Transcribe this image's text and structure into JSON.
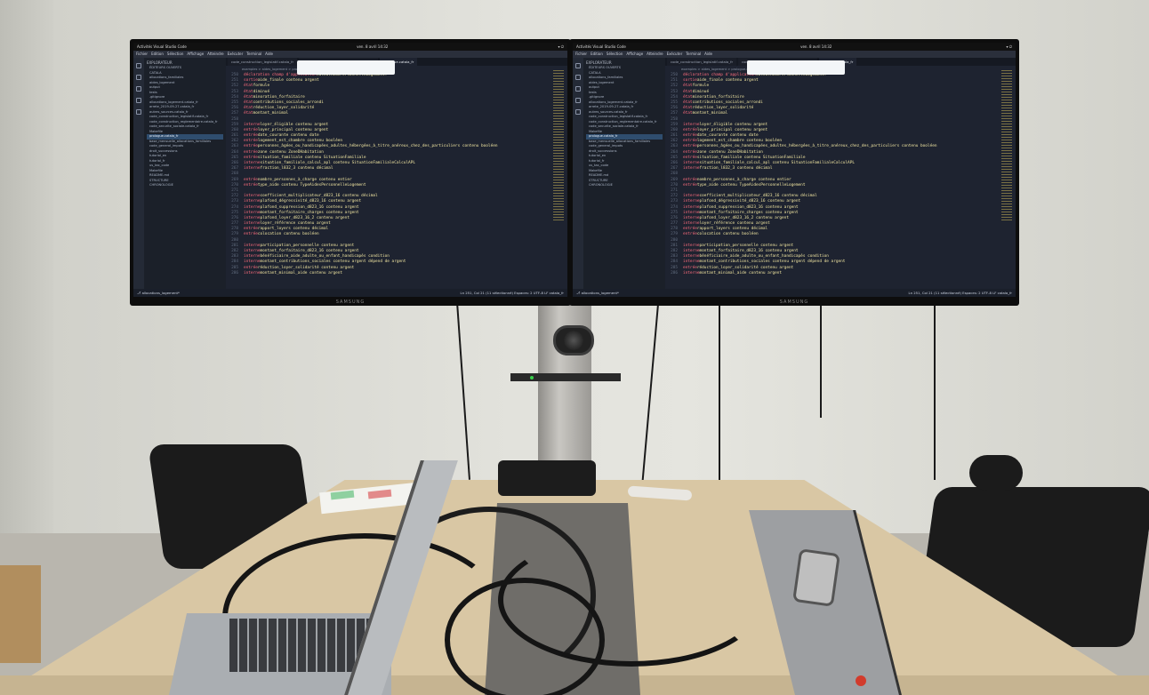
{
  "scene": "Meeting room with two Samsung monitors showing Visual Studio Code",
  "monitors": {
    "brand": "SAMSUNG",
    "left": {
      "topbar_left": "Activités   Visual Studio Code",
      "topbar_center": "ven. 8 avril 14:32",
      "menu": [
        "Fichier",
        "Edition",
        "Sélection",
        "Affichage",
        "Atteindre",
        "Exécuter",
        "Terminal",
        "Aide"
      ],
      "explorer_title": "EXPLORATEUR",
      "explorer_items": [
        "ÉDITEURS OUVERTS",
        "CATALA",
        "allocations_familiales",
        "aides_logement",
        "output",
        "tests",
        ".gitignore",
        "allocations_logement.catala_fr",
        "arrete_2019-09-27.catala_fr",
        "autres_sources.catala_fr",
        "code_construction_legislatif.catala_fr",
        "code_construction_reglementaire.catala_fr",
        "code_securite_sociale.catala_fr",
        "Makefile",
        "prologue.catala_fr",
        "base_mensuelle_allocations_familiales",
        "code_general_impots",
        "droit_successions",
        "tutorial_en",
        "tutorial_fr",
        "us_tax_code",
        "Makefile",
        "README.md",
        "STRUCTURE",
        "CHRONOLOGIE"
      ],
      "tabs": [
        "code_construction_legislatif.catala_fr",
        "code_construction_reglementaire.catala_fr",
        "prologue.catala_fr"
      ],
      "breadcrumb": "examples > aides_logement > prologue.catala_fr",
      "status": "Ln 251, Col 21 (11 sélectionné)   Espaces: 2   UTF-8   LF   catala_fr"
    },
    "right": {
      "topbar_left": "Activités   Visual Studio Code",
      "topbar_center": "ven. 8 avril 14:32",
      "menu": [
        "Fichier",
        "Edition",
        "Sélection",
        "Affichage",
        "Atteindre",
        "Exécuter",
        "Terminal",
        "Aide"
      ],
      "explorer_title": "EXPLORATEUR",
      "explorer_items": [
        "ÉDITEURS OUVERTS",
        "CATALA",
        "allocations_familiales",
        "aides_logement",
        "output",
        "tests",
        ".gitignore",
        "allocations_logement.catala_fr",
        "arrete_2019-09-27.catala_fr",
        "autres_sources.catala_fr",
        "code_construction_legislatif.catala_fr",
        "code_construction_reglementaire.catala_fr",
        "code_securite_sociale.catala_fr",
        "Makefile",
        "prologue.catala_fr",
        "base_mensuelle_allocations_familiales",
        "code_general_impots",
        "droit_successions",
        "tutorial_en",
        "tutorial_fr",
        "us_tax_code",
        "Makefile",
        "README.md",
        "STRUCTURE",
        "CHRONOLOGIE"
      ],
      "tabs": [
        "code_construction_legislatif.catala_fr",
        "code_construction_reglementaire.catala_fr",
        "prologue.catala_fr"
      ],
      "breadcrumb": "examples > aides_logement > prologue.catala_fr",
      "status": "Ln 251, Col 21 (11 sélectionné)   Espaces: 2   UTF-8   LF   catala_fr"
    }
  },
  "code_lines": [
    {
      "n": "250",
      "kw": "déclaration champ d'application",
      "tx": " CalculAidePersonnelleLogement:"
    },
    {
      "n": "251",
      "kw": "  sortie",
      "tx": " aide_finale contenu argent"
    },
    {
      "n": "252",
      "kw": "  état",
      "tx": " formule"
    },
    {
      "n": "253",
      "kw": "  état",
      "tx": " diminué"
    },
    {
      "n": "254",
      "kw": "  état",
      "tx": " minoration_forfaitaire"
    },
    {
      "n": "255",
      "kw": "  état",
      "tx": " contributions_sociales_arrondi"
    },
    {
      "n": "256",
      "kw": "  état",
      "tx": " réduction_loyer_solidarité"
    },
    {
      "n": "257",
      "kw": "  état",
      "tx": " montant_minimal"
    },
    {
      "n": "258",
      "kw": "",
      "tx": ""
    },
    {
      "n": "259",
      "kw": "  interne",
      "tx": " loyer_éligible contenu argent"
    },
    {
      "n": "260",
      "kw": "  entrée",
      "tx": " loyer_principal contenu argent"
    },
    {
      "n": "261",
      "kw": "  entrée",
      "tx": " date_courante contenu date"
    },
    {
      "n": "262",
      "kw": "  entrée",
      "tx": " logement_est_chambre contenu booléen"
    },
    {
      "n": "263",
      "kw": "  entrée",
      "tx": " personnes_âgées_ou_handicapées_adultes_hébergées_à_titre_onéreux_chez_des_particuliers contenu booléen"
    },
    {
      "n": "264",
      "kw": "  entrée",
      "tx": " zone contenu ZoneDHabitation"
    },
    {
      "n": "265",
      "kw": "  entrée",
      "tx": " situation_familiale contenu SituationFamiliale"
    },
    {
      "n": "266",
      "kw": "  interne",
      "tx": " situation_familiale_calcul_apl contenu SituationFamilialeCalculAPL"
    },
    {
      "n": "267",
      "kw": "  interne",
      "tx": " fraction_l832_3 contenu décimal"
    },
    {
      "n": "268",
      "kw": "",
      "tx": ""
    },
    {
      "n": "269",
      "kw": "  entrée",
      "tx": " nombre_personnes_à_charge contenu entier"
    },
    {
      "n": "270",
      "kw": "  entrée",
      "tx": " type_aide contenu TypeAidesPersonnelleLogement"
    },
    {
      "n": "271",
      "kw": "",
      "tx": ""
    },
    {
      "n": "272",
      "kw": "  interne",
      "tx": " coefficient_multiplicateur_d823_16 contenu décimal"
    },
    {
      "n": "273",
      "kw": "  interne",
      "tx": " plafond_dégressivité_d823_16 contenu argent"
    },
    {
      "n": "274",
      "kw": "  interne",
      "tx": " plafond_suppression_d823_16 contenu argent"
    },
    {
      "n": "275",
      "kw": "  interne",
      "tx": " montant_forfaitaire_charges contenu argent"
    },
    {
      "n": "276",
      "kw": "  interne",
      "tx": " plafond_loyer_d823_16_2 contenu argent"
    },
    {
      "n": "277",
      "kw": "  interne",
      "tx": " loyer_référence contenu argent"
    },
    {
      "n": "278",
      "kw": "  entrée",
      "tx": " rapport_loyers contenu décimal"
    },
    {
      "n": "279",
      "kw": "  entrée",
      "tx": " colocation contenu booléen"
    },
    {
      "n": "280",
      "kw": "",
      "tx": ""
    },
    {
      "n": "281",
      "kw": "  interne",
      "tx": " participation_personnelle contenu argent"
    },
    {
      "n": "282",
      "kw": "  interne",
      "tx": " montant_forfaitaire_d823_16 contenu argent"
    },
    {
      "n": "283",
      "kw": "  interne",
      "tx": " bénéficiaire_aide_adulte_ou_enfant_handicapés condition"
    },
    {
      "n": "284",
      "kw": "  interne",
      "tx": " montant_contributions_sociales contenu argent dépend de argent"
    },
    {
      "n": "285",
      "kw": "  entrée",
      "tx": " réduction_loyer_solidarité contenu argent"
    },
    {
      "n": "286",
      "kw": "  interne",
      "tx": " montant_minimal_aide contenu argent"
    }
  ]
}
